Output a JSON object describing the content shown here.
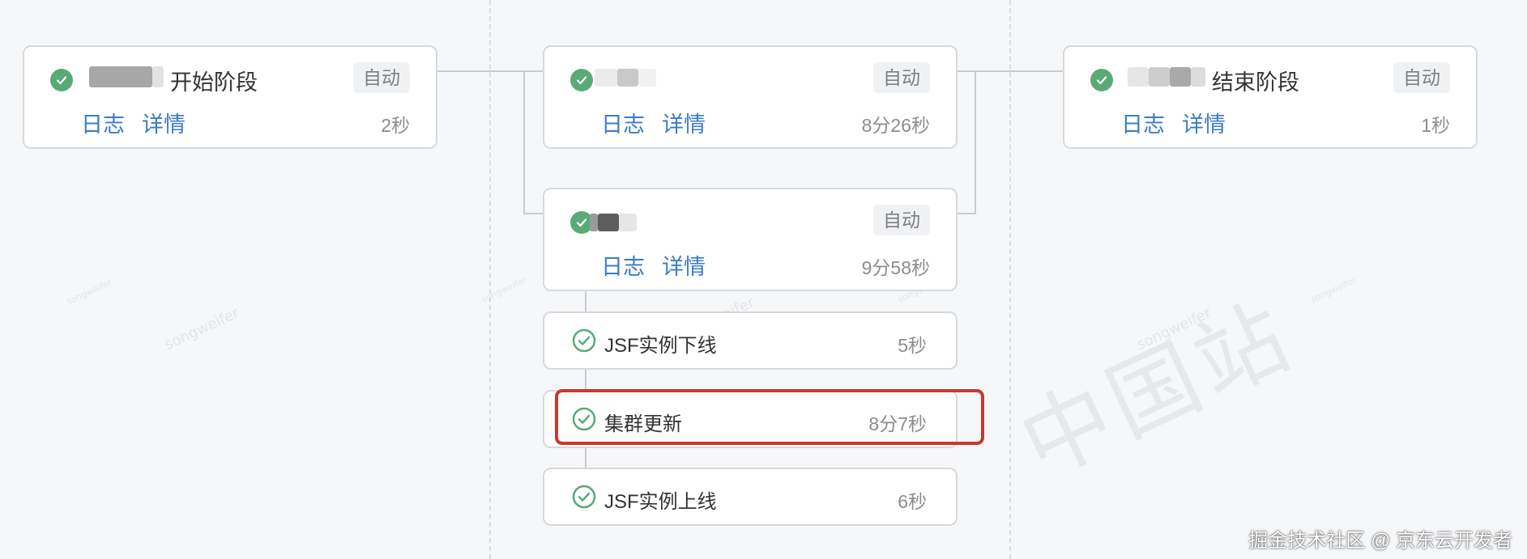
{
  "colors": {
    "success_green": "#5aaa78",
    "link_blue": "#3a7cc9",
    "highlight_red": "#c8392e"
  },
  "stages": {
    "start": {
      "title": "开始阶段",
      "tag": "自动",
      "log_label": "日志",
      "detail_label": "详情",
      "duration": "2秒",
      "status_icon": "check-circle-filled-icon"
    },
    "middle_top": {
      "title": "",
      "tag": "自动",
      "log_label": "日志",
      "detail_label": "详情",
      "duration": "8分26秒",
      "status_icon": "check-circle-filled-icon"
    },
    "middle_bottom": {
      "title": "",
      "tag": "自动",
      "log_label": "日志",
      "detail_label": "详情",
      "duration": "9分58秒",
      "status_icon": "check-circle-filled-icon"
    },
    "end": {
      "title": "结束阶段",
      "tag": "自动",
      "log_label": "日志",
      "detail_label": "详情",
      "duration": "1秒",
      "status_icon": "check-circle-filled-icon"
    }
  },
  "steps": [
    {
      "label": "JSF实例下线",
      "duration": "5秒",
      "icon": "check-circle-outline-icon",
      "highlighted": false
    },
    {
      "label": "集群更新",
      "duration": "8分7秒",
      "icon": "check-circle-outline-icon",
      "highlighted": true
    },
    {
      "label": "JSF实例上线",
      "duration": "6秒",
      "icon": "check-circle-outline-icon",
      "highlighted": false
    }
  ],
  "watermarks": {
    "big": "中国站",
    "small": "songweifer",
    "mini": "songweifer"
  },
  "footer": {
    "credit": "掘金技术社区 @ 京东云开发者"
  }
}
